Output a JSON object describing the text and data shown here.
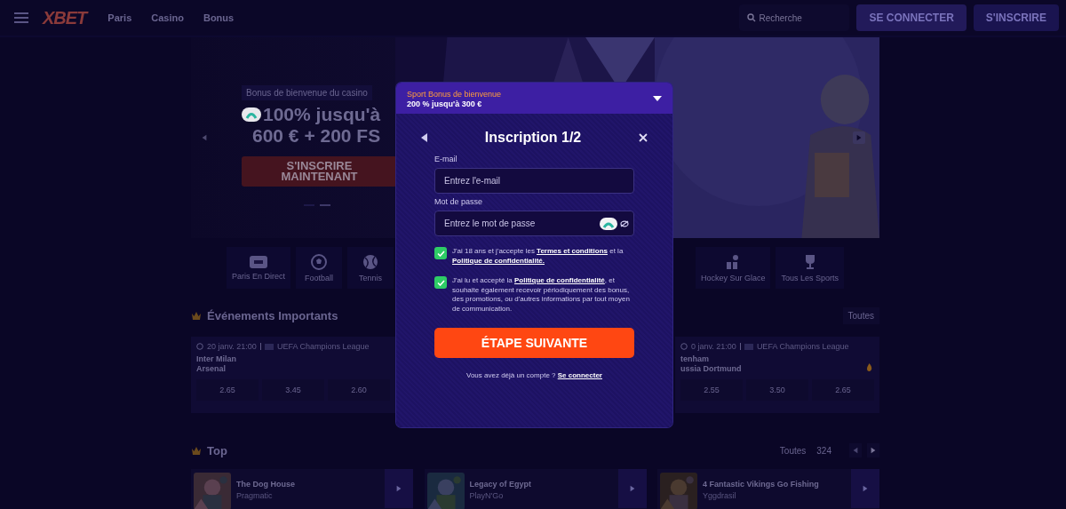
{
  "header": {
    "logo": "XBET",
    "nav": [
      "Paris",
      "Casino",
      "Bonus"
    ],
    "search": {
      "placeholder": "Recherche"
    },
    "buttons": [
      {
        "label": "SE CONNECTER",
        "kind": "login"
      },
      {
        "label": "S'INSCRIRE",
        "kind": "signup"
      }
    ]
  },
  "hero": {
    "tag": "Bonus de bienvenue du casino",
    "headline": [
      "100% jusqu'à",
      "600 € + 200 FS"
    ],
    "button": "S'INSCRIRE MAINTENANT",
    "dots": [
      {
        "selected": false
      },
      {
        "selected": true
      }
    ],
    "picture": {
      "kind": "picture"
    }
  },
  "sports": [
    {
      "label": "Paris En Direct",
      "kind": "live"
    },
    {
      "label": "Football",
      "kind": "football"
    },
    {
      "label": "Tennis",
      "kind": "tennis"
    },
    {
      "label": "Hockey Sur Glace",
      "kind": "hockey"
    },
    {
      "label": "Tous Les Sports",
      "kind": "trophy"
    }
  ],
  "events": {
    "title": "Événements Importants",
    "all": "Toutes",
    "cards": [
      {
        "time": "20 janv. 21:00",
        "league": "UEFA Champions League",
        "teams": [
          "Inter Milan",
          "Arsenal"
        ],
        "odds": [
          "2.65",
          "3.45",
          "2.60"
        ],
        "hot": false
      },
      {
        "time": "0 janv. 21:00",
        "league": "UEFA Champions League",
        "teams": [
          "tenham",
          "ussia Dortmund"
        ],
        "odds": [
          "2.55",
          "3.50",
          "2.65"
        ],
        "hot": true
      }
    ]
  },
  "top": {
    "title": "Top",
    "all": "Toutes",
    "count": "324",
    "games": [
      {
        "title": "The Dog House",
        "provider": "Pragmatic"
      },
      {
        "title": "Legacy of Egypt",
        "provider": "PlayN'Go"
      },
      {
        "title": "4 Fantastic Vikings Go Fishing",
        "provider": "Yggdrasil"
      }
    ]
  },
  "modal": {
    "bonus": {
      "title": "Sport Bonus de bienvenue",
      "subtitle": "200 % jusqu'à 300 €",
      "expanded": false
    },
    "title": "Inscription 1/2",
    "fields": [
      {
        "label": "E-mail",
        "placeholder": "Entrez l'e-mail",
        "kind": "email"
      },
      {
        "label": "Mot de passe",
        "placeholder": "Entrez le mot de passe",
        "kind": "password"
      }
    ],
    "consents": [
      {
        "checked": true,
        "parts": [
          {
            "text": "J'ai 18 ans et j'accepte les ",
            "kind": "text"
          },
          {
            "text": "Termes et conditions",
            "kind": "link"
          },
          {
            "text": " et la ",
            "kind": "text"
          },
          {
            "text": "Politique de confidentialité.",
            "kind": "link"
          }
        ]
      },
      {
        "checked": true,
        "parts": [
          {
            "text": "J'ai lu et accepté la ",
            "kind": "text"
          },
          {
            "text": "Politique de confidentialité",
            "kind": "link"
          },
          {
            "text": ", et souhaite également recevoir périodiquement des bonus, des promotions, ou d'autres informations par tout moyen de communication.",
            "kind": "text"
          }
        ]
      }
    ],
    "submit": "ÉTAPE SUIVANTE",
    "footer": {
      "text": "Vous avez déjà un compte ?",
      "link": "Se connecter"
    }
  }
}
